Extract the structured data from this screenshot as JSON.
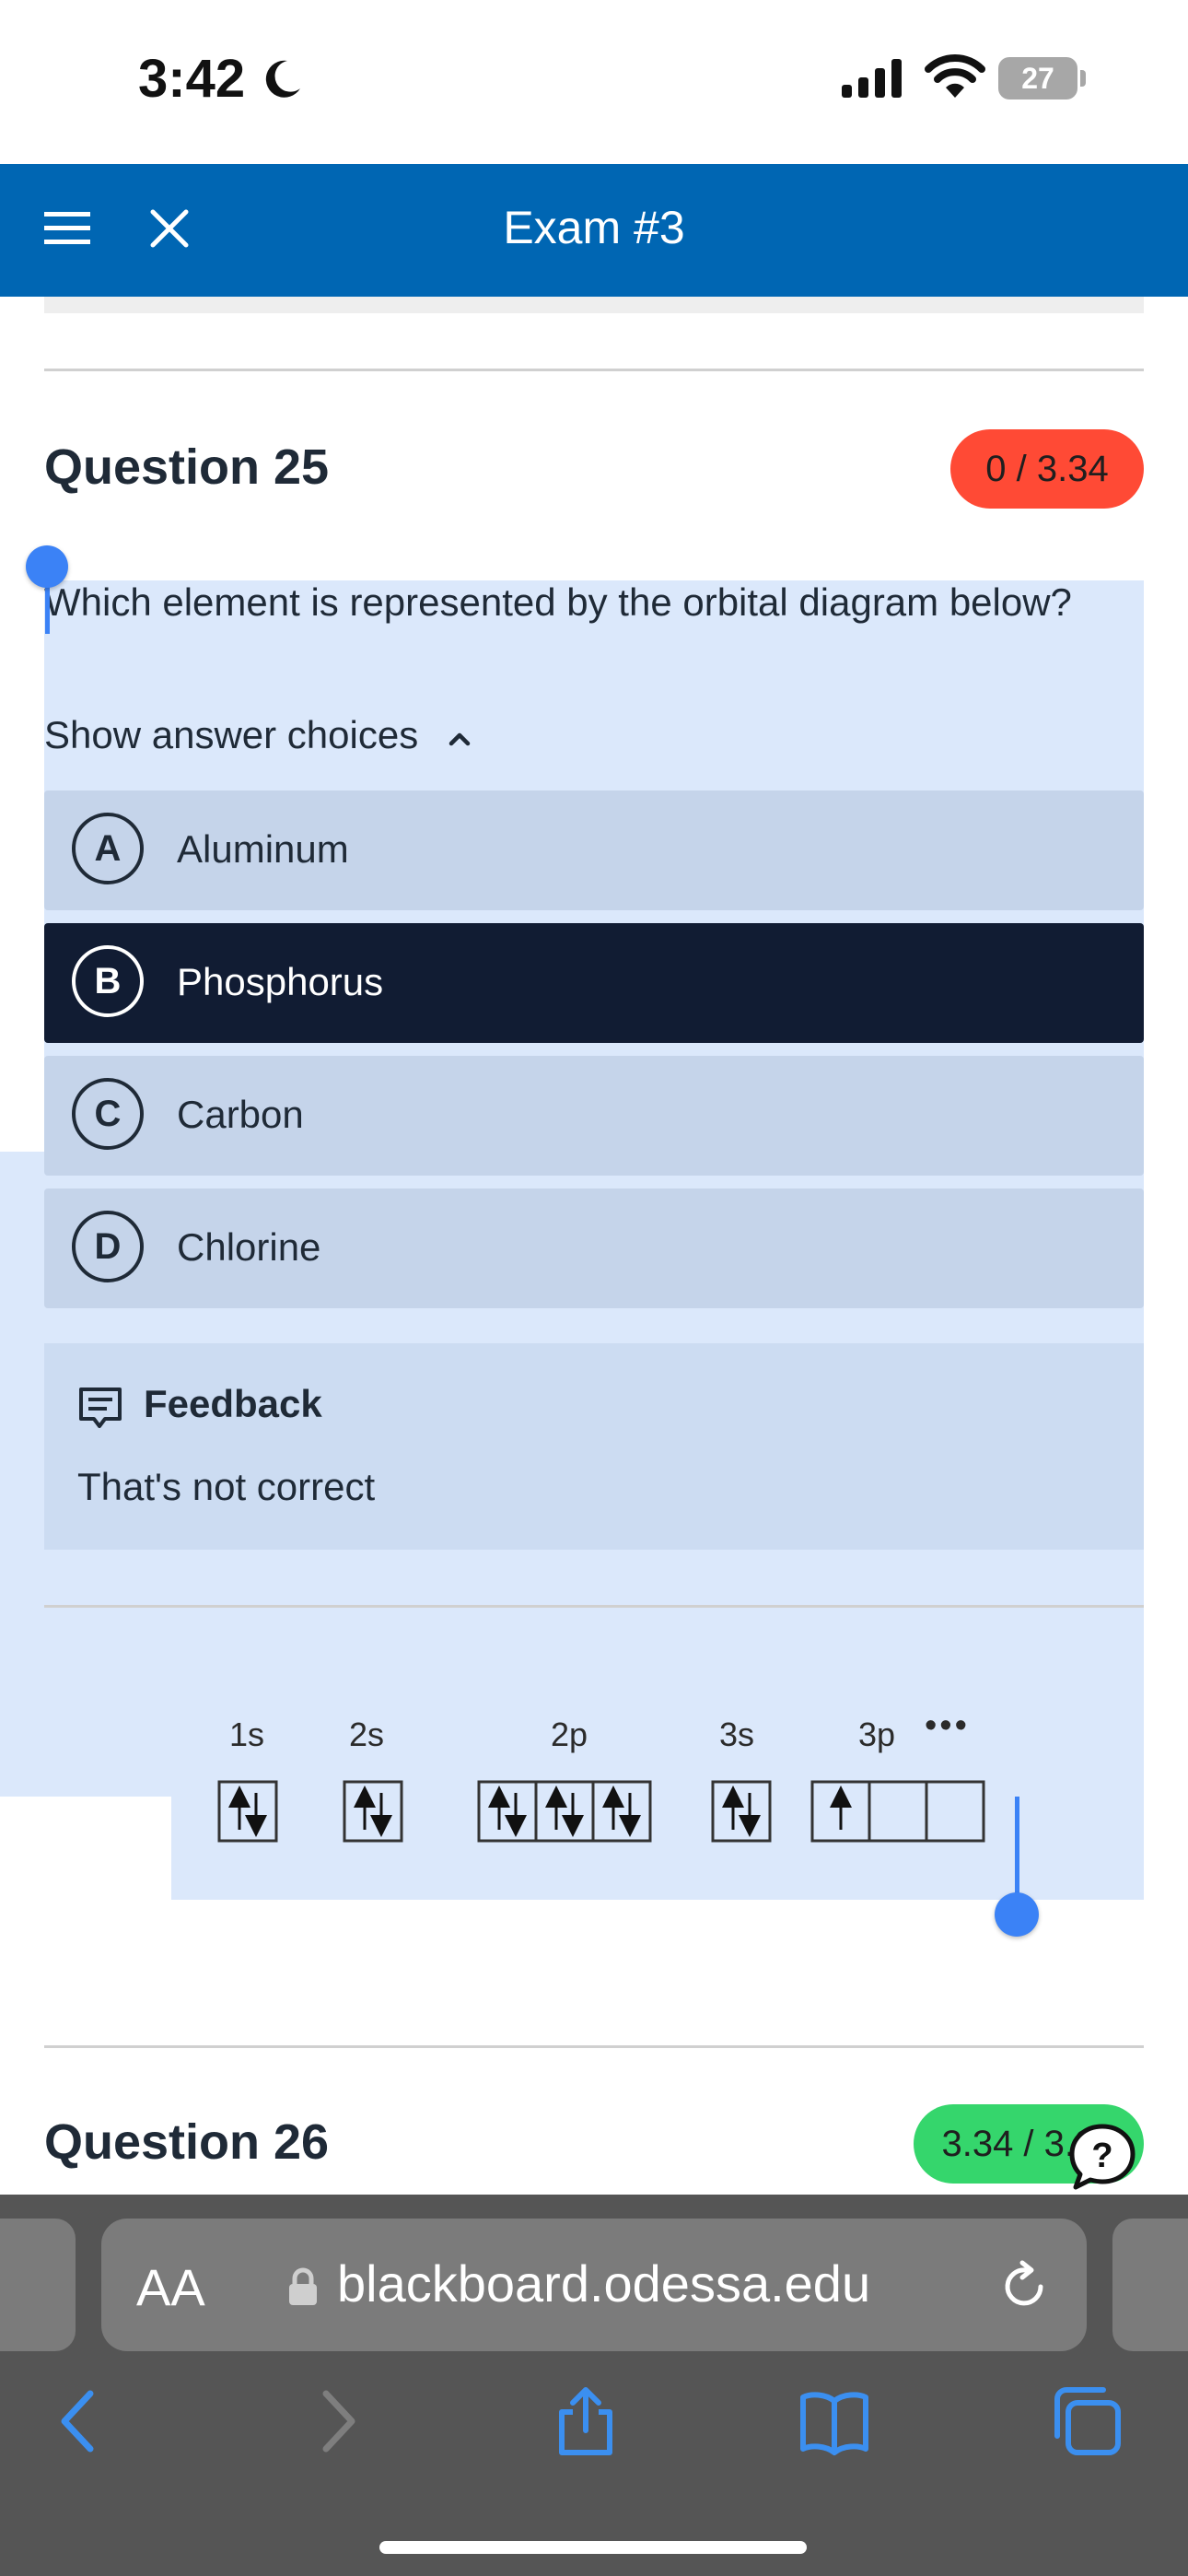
{
  "status": {
    "time": "3:42",
    "battery": "27"
  },
  "header": {
    "title": "Exam #3"
  },
  "question25": {
    "title": "Question 25",
    "score": "0 / 3.34",
    "prompt": "Which element is represented by the orbital diagram below?",
    "toggle_label": "Show answer choices",
    "choices": [
      {
        "letter": "A",
        "label": "Aluminum",
        "selected": false
      },
      {
        "letter": "B",
        "label": "Phosphorus",
        "selected": true
      },
      {
        "letter": "C",
        "label": "Carbon",
        "selected": false
      },
      {
        "letter": "D",
        "label": "Chlorine",
        "selected": false
      }
    ],
    "feedback_title": "Feedback",
    "feedback_text": "That's not correct",
    "orbitals": {
      "labels": [
        "1s",
        "2s",
        "2p",
        "3s",
        "3p"
      ],
      "more": "•••"
    }
  },
  "question26": {
    "title": "Question 26",
    "score": "3.34 / 3.34"
  },
  "browser": {
    "aa": "AA",
    "url": "blackboard.odessa.edu"
  }
}
